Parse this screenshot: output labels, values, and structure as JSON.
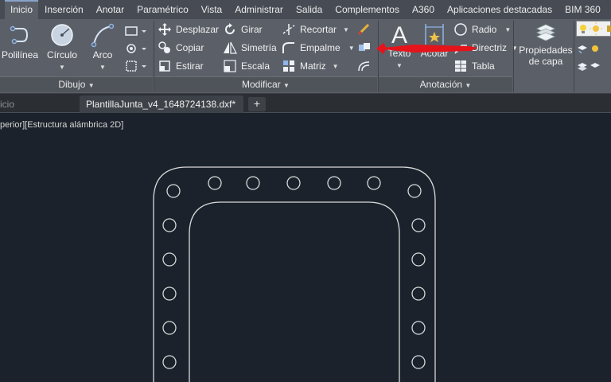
{
  "ribbon_tabs": [
    "Inicio",
    "Inserción",
    "Anotar",
    "Paramétrico",
    "Vista",
    "Administrar",
    "Salida",
    "Complementos",
    "A360",
    "Aplicaciones destacadas",
    "BIM 360"
  ],
  "dibujo": {
    "polilinea": "Polilínea",
    "circulo": "Círculo",
    "arco": "Arco",
    "panel_title": "Dibujo"
  },
  "modificar": {
    "desplazar": "Desplazar",
    "girar": "Girar",
    "recortar": "Recortar",
    "copiar": "Copiar",
    "simetria": "Simetría",
    "empalme": "Empalme",
    "estirar": "Estirar",
    "escala": "Escala",
    "matriz": "Matriz",
    "panel_title": "Modificar"
  },
  "anotacion": {
    "texto": "Texto",
    "acotar": "Acotar",
    "radio": "Radio",
    "directriz": "Directriz",
    "tabla": "Tabla",
    "panel_title": "Anotación"
  },
  "capas": {
    "propiedades_line1": "Propiedades",
    "propiedades_line2": "de capa"
  },
  "file_tabs": {
    "inicio": "icio",
    "active_file": "PlantillaJunta_v4_1648724138.dxf*",
    "close": "×",
    "new_tab": "+"
  },
  "viewport_label": "perior][Estructura alámbrica 2D]",
  "colors": {
    "ribbon_bg": "#5b6068",
    "tabbar_bg": "#474c54",
    "canvas_bg": "#1b222b",
    "drawing_line": "#d9d9d9",
    "annotation_arrow": "#e5141b"
  }
}
